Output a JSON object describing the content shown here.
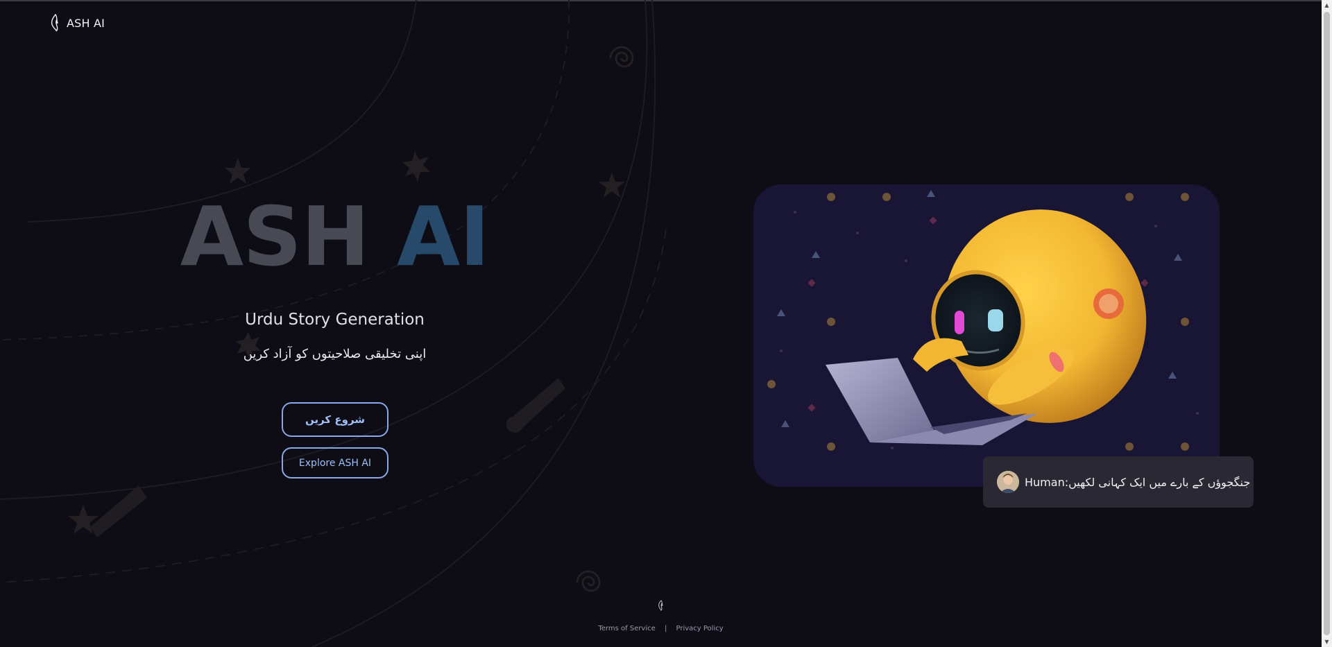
{
  "header": {
    "brand_name": "ASH AI"
  },
  "hero": {
    "title_word1": "ASH",
    "title_word2": "AI",
    "subtitle": "Urdu Story Generation",
    "tagline": "اپنی تخلیقی صلاحیتوں کو آزاد کریں",
    "start_button_label": "شروع کریں",
    "explore_button_label": "Explore ASH AI"
  },
  "prompt_bubble": {
    "text": "Human:جنگجوؤں کے بارے میں ایک کہانی لکھیں"
  },
  "footer": {
    "terms_label": "Terms of Service",
    "separator": "|",
    "privacy_label": "Privacy Policy"
  },
  "colors": {
    "background": "#0e0d16",
    "title_gray": "#474a52",
    "title_blue": "#27496a",
    "button_border": "#8aa9e8",
    "bubble_bg": "#2a2933",
    "image_bg": "#191535",
    "robot_yellow": "#f2b632"
  },
  "icons": {
    "brand_logo": "flame-logo-icon",
    "prompt_avatar": "user-avatar-icon",
    "hero_image": "robot-laptop-illustration"
  }
}
